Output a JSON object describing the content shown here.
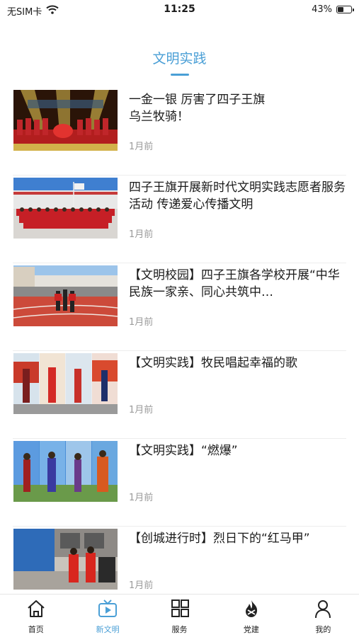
{
  "status_bar": {
    "carrier": "无SIM卡",
    "time": "11:25",
    "battery": "43%"
  },
  "page": {
    "title": "文明实践"
  },
  "news": [
    {
      "title": "一金一银 厉害了四子王旗\n乌兰牧骑！",
      "time": "1月前",
      "image": "stage-performance"
    },
    {
      "title": "四子王旗开展新时代文明实践志愿者服务活动 传递爱心传播文明",
      "time": "1月前",
      "image": "volunteer-group-photo"
    },
    {
      "title": "【文明校园】四子王旗各学校开展“中华民族一家亲、同心共筑中…",
      "time": "1月前",
      "image": "school-sports-track"
    },
    {
      "title": "【文明实践】牧民唱起幸福的歌",
      "time": "1月前",
      "image": "herders-singing-collage"
    },
    {
      "title": "【文明实践】“燃爆”",
      "time": "1月前",
      "image": "dancers-collage"
    },
    {
      "title": "【创城进行时】烈日下的“红马甲”",
      "time": "1月前",
      "image": "red-vest-volunteers"
    }
  ],
  "tabs": [
    {
      "label": "首页",
      "icon": "home-icon",
      "active": false
    },
    {
      "label": "新文明",
      "icon": "tv-play-icon",
      "active": true
    },
    {
      "label": "服务",
      "icon": "grid-icon",
      "active": false
    },
    {
      "label": "党建",
      "icon": "flame-icon",
      "active": false
    },
    {
      "label": "我的",
      "icon": "user-icon",
      "active": false
    }
  ],
  "colors": {
    "accent": "#4a9fd6",
    "text": "#1a1a1a",
    "muted": "#9a9a9a"
  }
}
